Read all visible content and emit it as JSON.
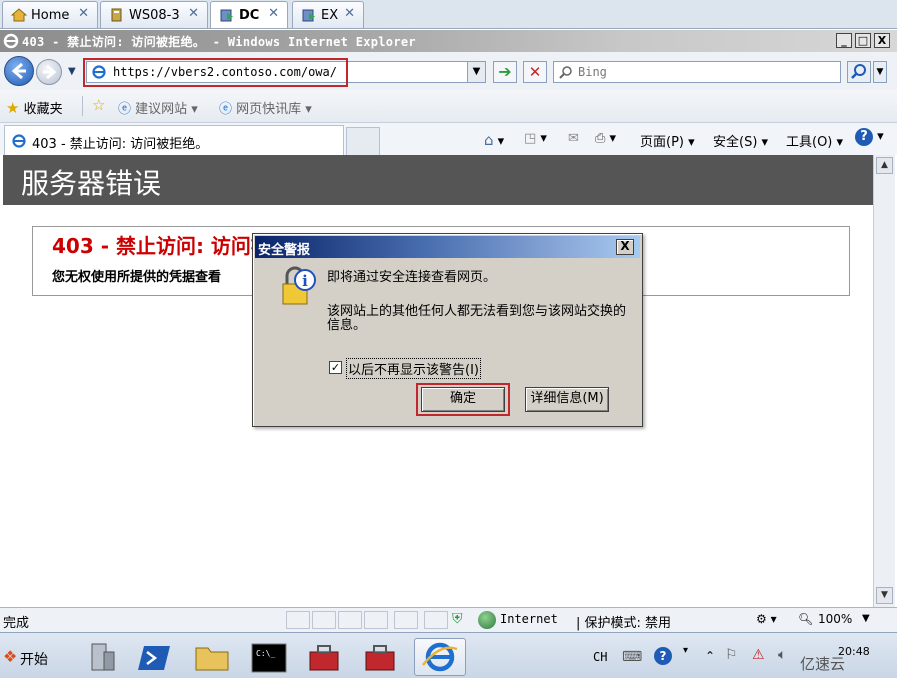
{
  "vm_tabs": [
    {
      "label": "Home",
      "icon": "home-icon"
    },
    {
      "label": "WS08-3",
      "icon": "vm-server-icon"
    },
    {
      "label": "DC",
      "icon": "vm-running-icon",
      "bold": true
    },
    {
      "label": "EX",
      "icon": "vm-running-icon"
    }
  ],
  "window": {
    "title": "403 - 禁止访问: 访问被拒绝。 - Windows Internet Explorer",
    "minimize_glyph": "_",
    "maximize_glyph": "□",
    "close_glyph": "X"
  },
  "address_bar": {
    "url": "https://vbers2.contoso.com/owa/",
    "search_placeholder": "Bing"
  },
  "favorites_bar": {
    "favorites_label": "收藏夹",
    "items": [
      "建议网站 ▾",
      "网页快讯库 ▾"
    ]
  },
  "tab": {
    "title": "403 - 禁止访问: 访问被拒绝。"
  },
  "command_bar": {
    "page": "页面(P) ▾",
    "safety": "安全(S) ▾",
    "tools": "工具(O) ▾"
  },
  "page": {
    "header": "服务器错误",
    "error_title": "403 - 禁止访问: 访问被拒绝。",
    "error_desc": "您无权使用所提供的凭据查看"
  },
  "dialog": {
    "title": "安全警报",
    "close_glyph": "X",
    "line1": "即将通过安全连接查看网页。",
    "line2": "该网站上的其他任何人都无法看到您与该网站交换的信息。",
    "checkbox_label": "以后不再显示该警告(I)",
    "checkbox_checked": true,
    "ok_label": "确定",
    "details_label": "详细信息(M)"
  },
  "status_bar": {
    "status": "完成",
    "zone": "Internet",
    "protected_mode": "| 保护模式: 禁用",
    "zoom": "100%"
  },
  "taskbar": {
    "start_label": "开始",
    "lang": "CH",
    "clock": "20:48",
    "watermark": "亿速云"
  },
  "colors": {
    "highlight": "#c0282d",
    "error_red": "#cc0000",
    "header_gray": "#555555"
  }
}
